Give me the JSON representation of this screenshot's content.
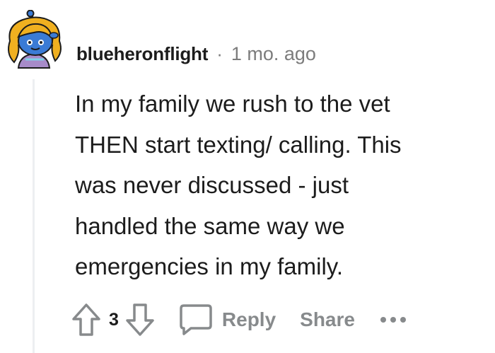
{
  "comment": {
    "author": "blueheronflight",
    "separator": "·",
    "timestamp": "1 mo. ago",
    "body": "In my family we rush to the vet\nTHEN start texting/ calling. This\nwas never discussed - just\nhandled the same way we\nemergencies in my family.",
    "vote_count": "3",
    "actions": {
      "reply_label": "Reply",
      "share_label": "Share"
    }
  },
  "icons": {
    "avatar": "snoo-avatar",
    "upvote": "arrow-up-icon",
    "downvote": "arrow-down-icon",
    "comment": "speech-bubble-icon",
    "more": "more-options-icon"
  },
  "colors": {
    "text": "#1c1c1c",
    "muted": "#878a8c",
    "timestamp": "#7c7c7c",
    "thread_line": "#edeff1",
    "avatar_skin": "#3a7bd5",
    "avatar_hair": "#f0b020"
  }
}
